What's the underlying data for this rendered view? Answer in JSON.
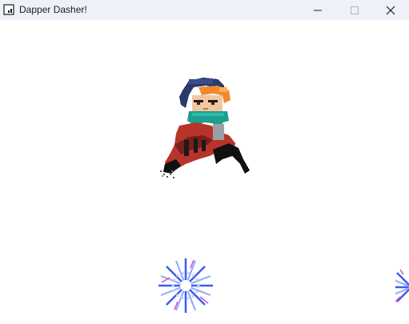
{
  "window": {
    "title": "Dapper Dasher!",
    "controls": {
      "minimize_icon": "minimize-icon",
      "maximize_icon": "maximize-icon",
      "close_icon": "close-icon"
    }
  },
  "scene": {
    "background_color": "#ffffff",
    "player": {
      "sprite": "scarfy-character",
      "colors": {
        "hood": "#2b3a6b",
        "hair": "#f08a2a",
        "scarf": "#1f9e8e",
        "coat": "#b8342a",
        "outline": "#111111"
      }
    },
    "hazards": [
      {
        "sprite": "nebula-hazard",
        "colors": [
          "#3c5cf0",
          "#8fa6ff",
          "#d04bd0",
          "#ffffff"
        ]
      },
      {
        "sprite": "nebula-hazard",
        "colors": [
          "#3c5cf0",
          "#8fa6ff",
          "#d04bd0",
          "#ffffff"
        ]
      }
    ]
  }
}
